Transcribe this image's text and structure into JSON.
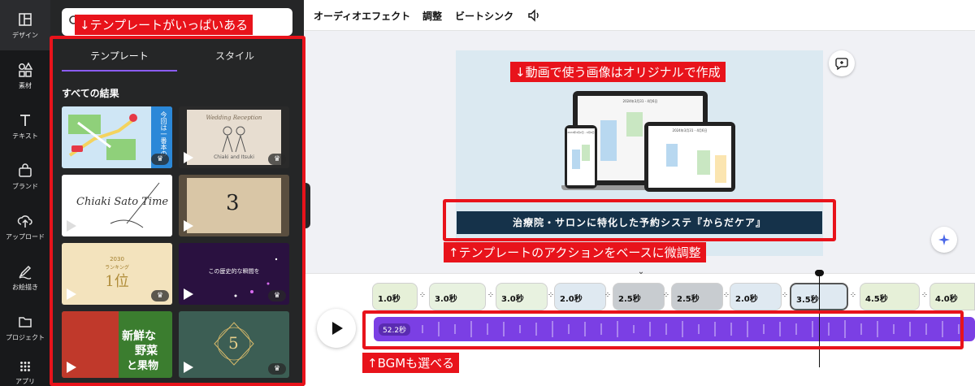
{
  "rail": {
    "items": [
      {
        "label": "デザイン",
        "icon": "layout-icon"
      },
      {
        "label": "素材",
        "icon": "shapes-icon"
      },
      {
        "label": "テキスト",
        "icon": "text-icon"
      },
      {
        "label": "ブランド",
        "icon": "brand-icon"
      },
      {
        "label": "アップロード",
        "icon": "upload-icon"
      },
      {
        "label": "お絵描き",
        "icon": "draw-icon"
      },
      {
        "label": "プロジェクト",
        "icon": "folder-icon"
      },
      {
        "label": "アプリ",
        "icon": "apps-icon"
      }
    ]
  },
  "panel": {
    "tabs": [
      {
        "label": "テンプレート",
        "active": true
      },
      {
        "label": "スタイル",
        "active": false
      }
    ],
    "results_title": "すべての結果",
    "tiles": {
      "t2_title": "Wedding Reception",
      "t2_names": "Chiaki and Itsuki",
      "t1_vertical": "今回は一番本の",
      "t3_script": "Chiaki Sato Time",
      "t4_number": "3",
      "t5_year": "2030",
      "t5_rank": "ランキング",
      "t5_first": "1位",
      "t6_text": "この歴史的な瞬間を",
      "t7_text_a": "新鮮な",
      "t7_text_b": "野菜",
      "t7_text_c": "と果物",
      "t8_number": "5",
      "crown": "♛"
    }
  },
  "topbar": {
    "audio_effects": "オーディオエフェクト",
    "adjust": "調整",
    "beat_sync": "ビートシンク"
  },
  "slide": {
    "caption": "治療院・サロンに特化した予約システ『からだケア』",
    "calendar_header_a": "2024年3月31 - 4月6日",
    "calendar_header_b": "2024年3月31 - 4月6日",
    "calendar_header_c": "2024年4月2日 - 4月6日"
  },
  "timeline": {
    "clips": [
      "1.0秒",
      "3.0秒",
      "3.0秒",
      "2.0秒",
      "2.5秒",
      "2.5秒",
      "2.0秒",
      "3.5秒",
      "4.5秒",
      "4.0秒"
    ],
    "audio_duration": "52.2秒"
  },
  "annotations": {
    "templates": "↓テンプレートがいっぱいある",
    "images": "↓動画で使う画像はオリジナルで作成",
    "action": "↑テンプレートのアクションをベースに微調整",
    "bgm": "↑BGMも選べる"
  },
  "colors": {
    "accent": "#8b5cf6",
    "annotation_red": "#e8131b",
    "audio_track": "#7b3fe4",
    "caption_bg": "#15324a"
  }
}
